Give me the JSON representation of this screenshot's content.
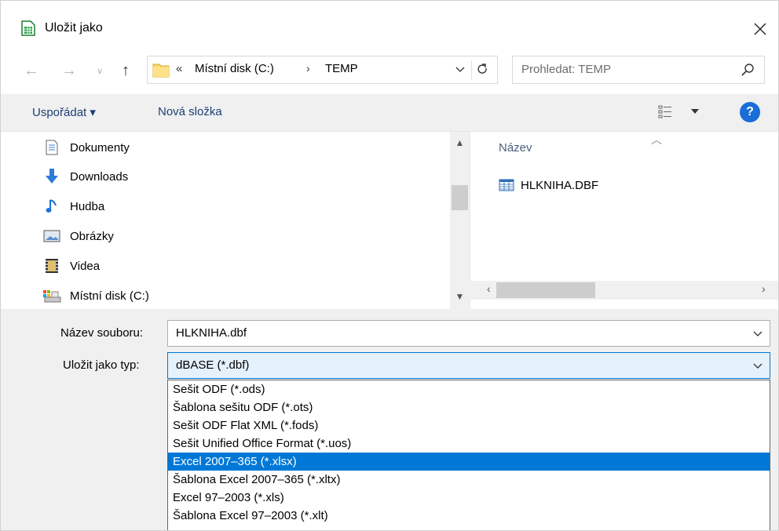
{
  "window": {
    "title": "Uložit jako"
  },
  "nav": {
    "address": [
      "Místní disk (C:)",
      "TEMP"
    ],
    "overflow_glyph": "«",
    "search_placeholder": "Prohledat: TEMP"
  },
  "toolbar": {
    "organize_label": "Uspořádat ▾",
    "new_folder_label": "Nová složka",
    "help_label": "?"
  },
  "sidebar": {
    "items": [
      {
        "label": "Dokumenty",
        "icon": "documents-icon"
      },
      {
        "label": "Downloads",
        "icon": "download-icon"
      },
      {
        "label": "Hudba",
        "icon": "music-icon"
      },
      {
        "label": "Obrázky",
        "icon": "pictures-icon"
      },
      {
        "label": "Videa",
        "icon": "videos-icon"
      },
      {
        "label": "Místní disk (C:)",
        "icon": "drive-icon"
      }
    ]
  },
  "files": {
    "column_name": "Název",
    "rows": [
      {
        "name": "HLKNIHA.DBF",
        "icon": "dbf-file-icon"
      }
    ]
  },
  "form": {
    "filename_label": "Název souboru:",
    "filename_value": "HLKNIHA.dbf",
    "type_label": "Uložit jako typ:",
    "type_value": "dBASE (*.dbf)"
  },
  "type_options": [
    "Sešit ODF (*.ods)",
    "Šablona sešitu ODF (*.ots)",
    "Sešit ODF Flat XML (*.fods)",
    "Sešit Unified Office Format (*.uos)",
    "Excel 2007–365 (*.xlsx)",
    "Šablona Excel 2007–365 (*.xltx)",
    "Excel 97–2003 (*.xls)",
    "Šablona Excel 97–2003 (*.xlt)"
  ],
  "selected_type_option": "Excel 2007–365 (*.xlsx)",
  "colors": {
    "accent": "#0078d7",
    "toolbar_bg": "#f0f0f0",
    "link": "#1a3f73",
    "help": "#1a6ed8"
  }
}
